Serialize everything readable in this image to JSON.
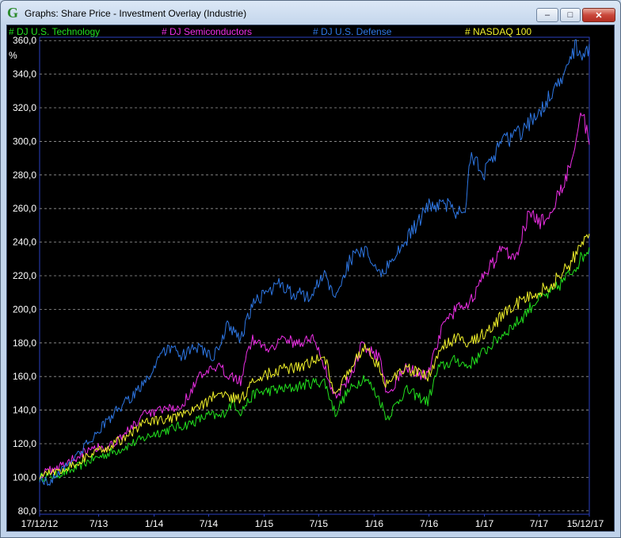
{
  "window": {
    "title": "Graphs: Share Price - Investment Overlay (Industrie)",
    "controls": {
      "minimize": "–",
      "maximize": "□",
      "close": "✕"
    }
  },
  "colors": {
    "background": "#000000",
    "grid": "#9a9a9a",
    "axis_text": "#ffffff"
  },
  "chart_data": {
    "type": "line",
    "title": "",
    "xlabel": "",
    "ylabel": "%",
    "ylim": [
      78,
      362
    ],
    "xlim": [
      "2012-12-17",
      "2017-12-15"
    ],
    "grid": true,
    "legend_position": "top",
    "y_ticks": [
      {
        "value": 80,
        "label": "80,0"
      },
      {
        "value": 100,
        "label": "100,0"
      },
      {
        "value": 120,
        "label": "120,0"
      },
      {
        "value": 140,
        "label": "140,0"
      },
      {
        "value": 160,
        "label": "160,0"
      },
      {
        "value": 180,
        "label": "180,0"
      },
      {
        "value": 200,
        "label": "200,0"
      },
      {
        "value": 220,
        "label": "220,0"
      },
      {
        "value": 240,
        "label": "240,0"
      },
      {
        "value": 260,
        "label": "260,0"
      },
      {
        "value": 280,
        "label": "280,0"
      },
      {
        "value": 300,
        "label": "300,0"
      },
      {
        "value": 320,
        "label": "320,0"
      },
      {
        "value": 340,
        "label": "340,0"
      },
      {
        "value": 360,
        "label": "360,0"
      }
    ],
    "x_ticks": [
      {
        "date": "2012-12-17",
        "label": "17/12/12"
      },
      {
        "date": "2013-07-01",
        "label": "7/13"
      },
      {
        "date": "2014-01-01",
        "label": "1/14"
      },
      {
        "date": "2014-07-01",
        "label": "7/14"
      },
      {
        "date": "2015-01-01",
        "label": "1/15"
      },
      {
        "date": "2015-07-01",
        "label": "7/15"
      },
      {
        "date": "2016-01-01",
        "label": "1/16"
      },
      {
        "date": "2016-07-01",
        "label": "7/16"
      },
      {
        "date": "2017-01-01",
        "label": "1/17"
      },
      {
        "date": "2017-07-01",
        "label": "7/17"
      },
      {
        "date": "2017-12-15",
        "label": "15/12/17"
      }
    ],
    "series": [
      {
        "name": "DJ U.S. Technology",
        "legend": "# DJ U.S. Technology",
        "color": "#22e01e",
        "points": [
          [
            "2012-12-17",
            100
          ],
          [
            "2013-02-01",
            101
          ],
          [
            "2013-04-01",
            104
          ],
          [
            "2013-06-01",
            110
          ],
          [
            "2013-07-15",
            113
          ],
          [
            "2013-09-01",
            116
          ],
          [
            "2013-11-01",
            121
          ],
          [
            "2014-01-01",
            126
          ],
          [
            "2014-03-01",
            129
          ],
          [
            "2014-05-01",
            132
          ],
          [
            "2014-07-01",
            137
          ],
          [
            "2014-08-10",
            136
          ],
          [
            "2014-09-20",
            145
          ],
          [
            "2014-10-15",
            139
          ],
          [
            "2014-12-01",
            150
          ],
          [
            "2015-02-01",
            152
          ],
          [
            "2015-04-01",
            153
          ],
          [
            "2015-06-01",
            156
          ],
          [
            "2015-07-20",
            157
          ],
          [
            "2015-08-25",
            138
          ],
          [
            "2015-10-01",
            150
          ],
          [
            "2015-12-01",
            160
          ],
          [
            "2016-01-20",
            146
          ],
          [
            "2016-02-12",
            135
          ],
          [
            "2016-04-15",
            152
          ],
          [
            "2016-06-27",
            145
          ],
          [
            "2016-08-01",
            165
          ],
          [
            "2016-10-01",
            170
          ],
          [
            "2016-11-05",
            166
          ],
          [
            "2017-01-01",
            175
          ],
          [
            "2017-03-01",
            185
          ],
          [
            "2017-05-01",
            194
          ],
          [
            "2017-06-20",
            205
          ],
          [
            "2017-08-15",
            210
          ],
          [
            "2017-10-15",
            222
          ],
          [
            "2017-12-15",
            237
          ]
        ]
      },
      {
        "name": "DJ Semiconductors",
        "legend": "# DJ Semiconductors",
        "color": "#ee2ee6",
        "points": [
          [
            "2012-12-17",
            101
          ],
          [
            "2013-02-01",
            105
          ],
          [
            "2013-04-01",
            110
          ],
          [
            "2013-06-01",
            118
          ],
          [
            "2013-08-01",
            118
          ],
          [
            "2013-10-01",
            127
          ],
          [
            "2013-12-01",
            137
          ],
          [
            "2014-02-01",
            140
          ],
          [
            "2014-04-01",
            142
          ],
          [
            "2014-06-01",
            160
          ],
          [
            "2014-08-01",
            165
          ],
          [
            "2014-10-15",
            158
          ],
          [
            "2014-11-20",
            182
          ],
          [
            "2015-01-15",
            177
          ],
          [
            "2015-03-01",
            182
          ],
          [
            "2015-05-01",
            180
          ],
          [
            "2015-06-15",
            183
          ],
          [
            "2015-08-25",
            148
          ],
          [
            "2015-10-15",
            160
          ],
          [
            "2015-11-20",
            178
          ],
          [
            "2016-01-20",
            172
          ],
          [
            "2016-02-12",
            150
          ],
          [
            "2016-04-15",
            165
          ],
          [
            "2016-06-27",
            160
          ],
          [
            "2016-08-15",
            190
          ],
          [
            "2016-10-01",
            200
          ],
          [
            "2016-11-15",
            205
          ],
          [
            "2017-01-01",
            220
          ],
          [
            "2017-03-01",
            236
          ],
          [
            "2017-04-15",
            232
          ],
          [
            "2017-06-01",
            260
          ],
          [
            "2017-07-01",
            250
          ],
          [
            "2017-08-15",
            260
          ],
          [
            "2017-10-01",
            280
          ],
          [
            "2017-11-20",
            318
          ],
          [
            "2017-12-15",
            298
          ]
        ]
      },
      {
        "name": "DJ U.S. Defense",
        "legend": "# DJ U.S. Defense",
        "color": "#2e78e6",
        "points": [
          [
            "2012-12-17",
            99
          ],
          [
            "2013-01-20",
            97
          ],
          [
            "2013-03-01",
            105
          ],
          [
            "2013-05-01",
            115
          ],
          [
            "2013-07-01",
            128
          ],
          [
            "2013-09-01",
            140
          ],
          [
            "2013-11-01",
            150
          ],
          [
            "2014-01-01",
            165
          ],
          [
            "2014-02-15",
            178
          ],
          [
            "2014-04-01",
            172
          ],
          [
            "2014-06-01",
            178
          ],
          [
            "2014-07-15",
            170
          ],
          [
            "2014-09-01",
            190
          ],
          [
            "2014-10-15",
            183
          ],
          [
            "2014-12-01",
            205
          ],
          [
            "2015-02-15",
            215
          ],
          [
            "2015-04-01",
            210
          ],
          [
            "2015-06-01",
            208
          ],
          [
            "2015-07-20",
            220
          ],
          [
            "2015-08-25",
            208
          ],
          [
            "2015-10-15",
            230
          ],
          [
            "2015-12-01",
            235
          ],
          [
            "2016-01-20",
            220
          ],
          [
            "2016-03-01",
            230
          ],
          [
            "2016-05-01",
            245
          ],
          [
            "2016-07-01",
            262
          ],
          [
            "2016-09-01",
            262
          ],
          [
            "2016-10-25",
            255
          ],
          [
            "2016-11-15",
            290
          ],
          [
            "2017-01-01",
            282
          ],
          [
            "2017-03-01",
            300
          ],
          [
            "2017-05-01",
            305
          ],
          [
            "2017-06-15",
            315
          ],
          [
            "2017-08-01",
            325
          ],
          [
            "2017-09-15",
            335
          ],
          [
            "2017-11-01",
            358
          ],
          [
            "2017-11-25",
            350
          ],
          [
            "2017-12-15",
            358
          ]
        ]
      },
      {
        "name": "NASDAQ 100",
        "legend": "# NASDAQ 100",
        "color": "#f2f22a",
        "points": [
          [
            "2012-12-17",
            101
          ],
          [
            "2013-02-01",
            103
          ],
          [
            "2013-04-01",
            107
          ],
          [
            "2013-06-01",
            113
          ],
          [
            "2013-08-01",
            118
          ],
          [
            "2013-10-01",
            124
          ],
          [
            "2013-12-01",
            133
          ],
          [
            "2014-02-01",
            134
          ],
          [
            "2014-04-01",
            136
          ],
          [
            "2014-06-01",
            142
          ],
          [
            "2014-08-01",
            150
          ],
          [
            "2014-10-15",
            146
          ],
          [
            "2014-12-01",
            158
          ],
          [
            "2015-02-01",
            163
          ],
          [
            "2015-04-01",
            165
          ],
          [
            "2015-06-01",
            168
          ],
          [
            "2015-07-20",
            172
          ],
          [
            "2015-08-25",
            150
          ],
          [
            "2015-10-15",
            165
          ],
          [
            "2015-12-01",
            178
          ],
          [
            "2016-01-20",
            165
          ],
          [
            "2016-02-12",
            155
          ],
          [
            "2016-04-15",
            165
          ],
          [
            "2016-06-27",
            160
          ],
          [
            "2016-08-15",
            178
          ],
          [
            "2016-10-01",
            183
          ],
          [
            "2016-11-05",
            180
          ],
          [
            "2017-01-01",
            186
          ],
          [
            "2017-03-01",
            196
          ],
          [
            "2017-05-01",
            205
          ],
          [
            "2017-06-20",
            210
          ],
          [
            "2017-08-15",
            215
          ],
          [
            "2017-10-15",
            228
          ],
          [
            "2017-12-15",
            245
          ]
        ]
      }
    ]
  }
}
